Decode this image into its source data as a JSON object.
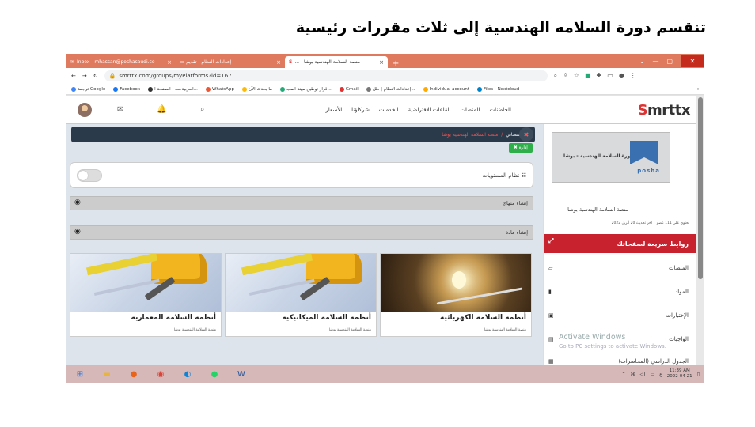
{
  "slide_title": "تنقسم دورة السلامه الهندسية إلى ثلاث مقررات رئيسية",
  "browser": {
    "tabs": [
      {
        "label": "Inbox - mhassan@poshasaudi.co"
      },
      {
        "label": "إعدادات النظام | تقديم"
      },
      {
        "label": "منصة السلامة الهندسية بوشا - ..."
      }
    ],
    "new_tab": "+",
    "url": "smrttx.com/groups/myPlatforms?id=167",
    "bookmarks": [
      "ترجمة Google",
      "Facebook",
      "العربية.نت | الصفحة ا...",
      "WhatsApp",
      "ما يحدث الآن",
      "قرار توطين مهنة المب...",
      "Gmail",
      "إعدادات النظام | طل...",
      "Individual account",
      "Files - Nextcloud"
    ],
    "more": "»"
  },
  "site": {
    "logo_s": "S",
    "logo_rest": "mrttx",
    "nav": [
      "الحاضنات",
      "المنصات",
      "القاعات الافتراضية",
      "الخدمات",
      "شركاؤنا",
      "الأسعار"
    ]
  },
  "main": {
    "breadcrumb_root": "منصاتي",
    "breadcrumb_sep": "/",
    "breadcrumb_current": "منصة السلامة الهندسية بوشا",
    "manage_label": "إدارة",
    "levels_label": "نظام المستويات",
    "create_curriculum": "إنشاء منهاج",
    "create_subject": "إنشاء مادة",
    "courses": [
      {
        "title": "أنظمة السلامة الكهربائية",
        "sub": "منصة السلامة الهندسية بوشا"
      },
      {
        "title": "أنظمة السلامة الميكانيكية",
        "sub": "منصة السلامة الهندسية بوشا"
      },
      {
        "title": "أنظمة السلامة المعمارية",
        "sub": "منصة السلامة الهندسية بوشا"
      }
    ]
  },
  "sidebar": {
    "logo_text": "دورة السلامة الهندسية - بوشا",
    "logo_brand": "posha",
    "platform_name": "منصة السلامة الهندسية بوشا",
    "members": "تحتوي على 111 عضو",
    "updated": "آخر تحديث 20 أبريل 2022",
    "quick_links": "روابط سريعة لصفحاتك",
    "items": [
      "المنصات",
      "المواد",
      "الإختبارات",
      "الواجبات",
      "الجدول الدراسي (المحاضرات)"
    ]
  },
  "watermark": {
    "title": "Activate Windows",
    "sub": "Go to PC settings to activate Windows."
  },
  "taskbar": {
    "time": "11:39 AM",
    "date": "2022-04-21",
    "lang": "ع"
  }
}
